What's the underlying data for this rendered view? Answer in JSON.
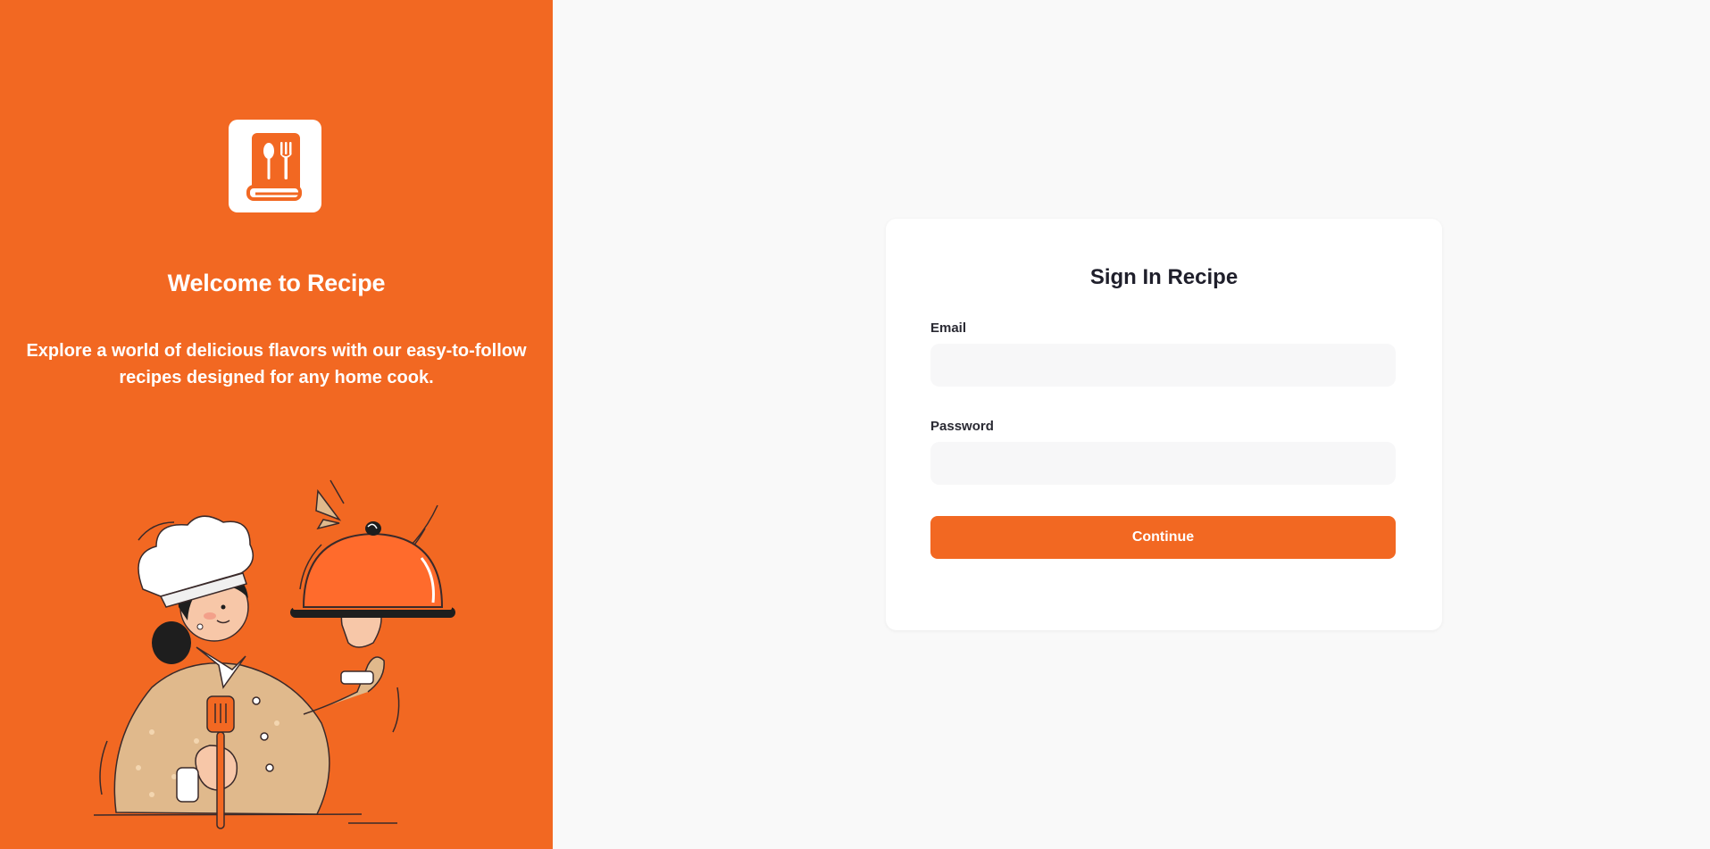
{
  "brand": {
    "welcome_title": "Welcome to Recipe",
    "welcome_subtitle": "Explore a world of delicious flavors with our easy-to-follow recipes designed for any home cook.",
    "logo_icon": "recipe-book-icon",
    "accent_color": "#f26822"
  },
  "signin": {
    "title": "Sign In Recipe",
    "email_label": "Email",
    "email_value": "",
    "email_placeholder": "",
    "password_label": "Password",
    "password_value": "",
    "password_placeholder": "",
    "continue_label": "Continue"
  }
}
